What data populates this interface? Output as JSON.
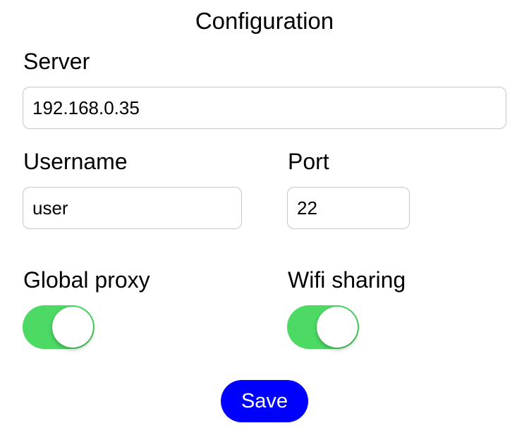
{
  "header": {
    "title": "Configuration"
  },
  "server": {
    "label": "Server",
    "value": "192.168.0.35"
  },
  "username": {
    "label": "Username",
    "value": "user"
  },
  "port": {
    "label": "Port",
    "value": "22"
  },
  "global_proxy": {
    "label": "Global proxy",
    "enabled": true
  },
  "wifi_sharing": {
    "label": "Wifi sharing",
    "enabled": true
  },
  "actions": {
    "save_label": "Save"
  },
  "colors": {
    "toggle_on": "#4cd964",
    "save_button": "#0000ff",
    "field_border": "#c7c7cc"
  }
}
